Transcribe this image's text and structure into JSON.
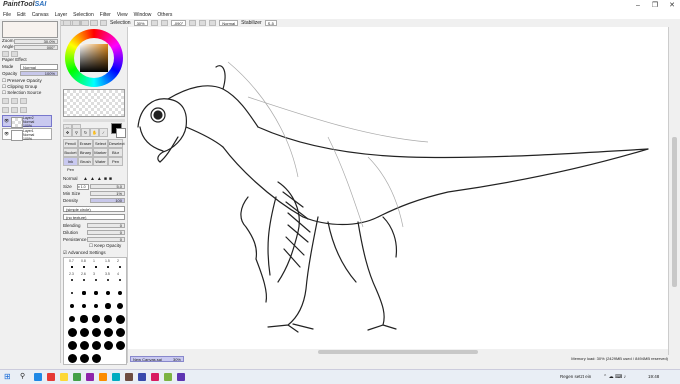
{
  "app": {
    "logo_prefix": "PaintTool",
    "logo_brand": "SAI"
  },
  "menu": [
    "File",
    "Edit",
    "Canvas",
    "Layer",
    "Selection",
    "Filter",
    "View",
    "Window",
    "Others"
  ],
  "toolbar": {
    "selection_label": "Selection",
    "zoom_value": "30%",
    "rotation_value": "-090°",
    "mode_value": "Normal",
    "stabilizer_label": "Stabilizer",
    "stabilizer_value": "S-5"
  },
  "navigator": {
    "zoom_label": "Zoom",
    "zoom_value": "30.0%",
    "angle_label": "Angle",
    "angle_value": "000°"
  },
  "layer_panel": {
    "paper_effect_label": "Paper Effect",
    "mode_label": "Mode",
    "mode_value": "Normal",
    "opacity_label": "Opacity",
    "opacity_value": "100%",
    "preserve_opacity_label": "Preserve Opacity",
    "clipping_group_label": "Clipping Group",
    "selection_source_label": "Selection Source",
    "layers": [
      {
        "name": "Layer2",
        "mode": "Normal",
        "opacity": "100%"
      },
      {
        "name": "Layer1",
        "mode": "Normal",
        "opacity": "100%"
      }
    ]
  },
  "tool_panel": {
    "tools": [
      "Pencil",
      "Eraser",
      "Select",
      "Deselect",
      "Bucket",
      "Binary",
      "Marker",
      "Blur",
      "Ink Pen",
      "Brush",
      "Water",
      "Pen"
    ],
    "blend_mode": "Normal",
    "size_label": "Size",
    "size_multiplier": "x 1.0",
    "size_value": "5.0",
    "min_size_label": "Min Size",
    "min_size_value": "1%",
    "density_label": "Density",
    "density_value": "100",
    "shape_value": "(simple circle)",
    "texture_value": "(no texture)",
    "blending_label": "Blending",
    "blending_value": "0",
    "dilution_label": "Dilution",
    "dilution_value": "0",
    "persistence_label": "Persistence",
    "persistence_value": "0",
    "keep_opacity_label": "Keep Opacity",
    "advanced_label": "Advanced Settings",
    "brush_sizes_row1": [
      "0.7",
      "0.8",
      "1",
      "1.5",
      "2"
    ],
    "brush_sizes_row2": [
      "2.3",
      "2.6",
      "3",
      "3.5",
      "4"
    ],
    "brush_sizes_row3": [
      "5",
      "6",
      "7",
      "8",
      "9"
    ],
    "brush_sizes_row4": [
      "10",
      "12",
      "14",
      "16",
      "20"
    ],
    "brush_sizes_row5": [
      "25",
      "30",
      "35",
      "40",
      "50"
    ],
    "brush_sizes_row6": [
      "60",
      "70",
      "80",
      "100",
      "120"
    ],
    "brush_sizes_row7": [
      "160",
      "200",
      "250",
      "300",
      "350"
    ],
    "brush_sizes_row8": [
      "400",
      "450",
      "500"
    ]
  },
  "status": {
    "doc_name": "New Canvas.sai",
    "doc_zoom": "30%",
    "memory": "Memory load: 30% (2429MB used / 8494MB reserved)"
  },
  "taskbar": {
    "weather": "Regen setzt ein",
    "time": "19:48",
    "icons_colors": [
      "#1e88e5",
      "#e53935",
      "#fdd835",
      "#43a047",
      "#8e24aa",
      "#fb8c00",
      "#00acc1",
      "#6d4c41",
      "#3949ab",
      "#d81b60",
      "#7cb342",
      "#5e35b1"
    ]
  },
  "colors": {
    "layer_selected": "#c9c9f0",
    "brand": "#2a6fbd"
  }
}
